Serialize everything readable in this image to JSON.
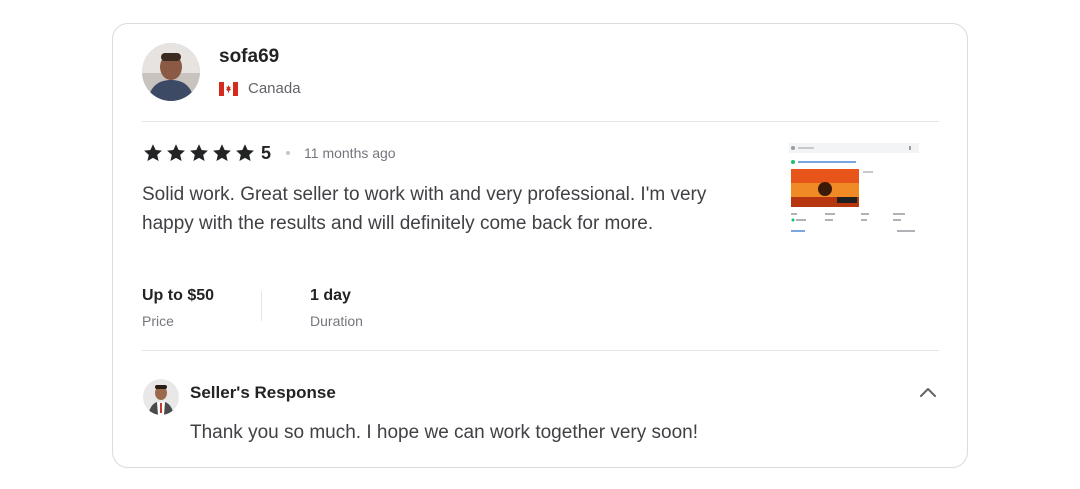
{
  "reviewer": {
    "username": "sofa69",
    "country": "Canada",
    "avatar_icon": "user-avatar",
    "flag_icon": "canada-flag-icon"
  },
  "review": {
    "rating": "5",
    "star_count": 5,
    "time_ago": "11 months ago",
    "text": "Solid work. Great seller to work with and very professional. I'm very happy with the results and will definitely come back for more.",
    "price_value": "Up to $50",
    "price_label": "Price",
    "duration_value": "1 day",
    "duration_label": "Duration"
  },
  "seller_response": {
    "title": "Seller's Response",
    "text": "Thank you so much. I hope we can work together very soon!"
  },
  "colors": {
    "star": "#222325",
    "text_primary": "#222325",
    "text_secondary": "#74767e",
    "border": "#dadbdd"
  }
}
